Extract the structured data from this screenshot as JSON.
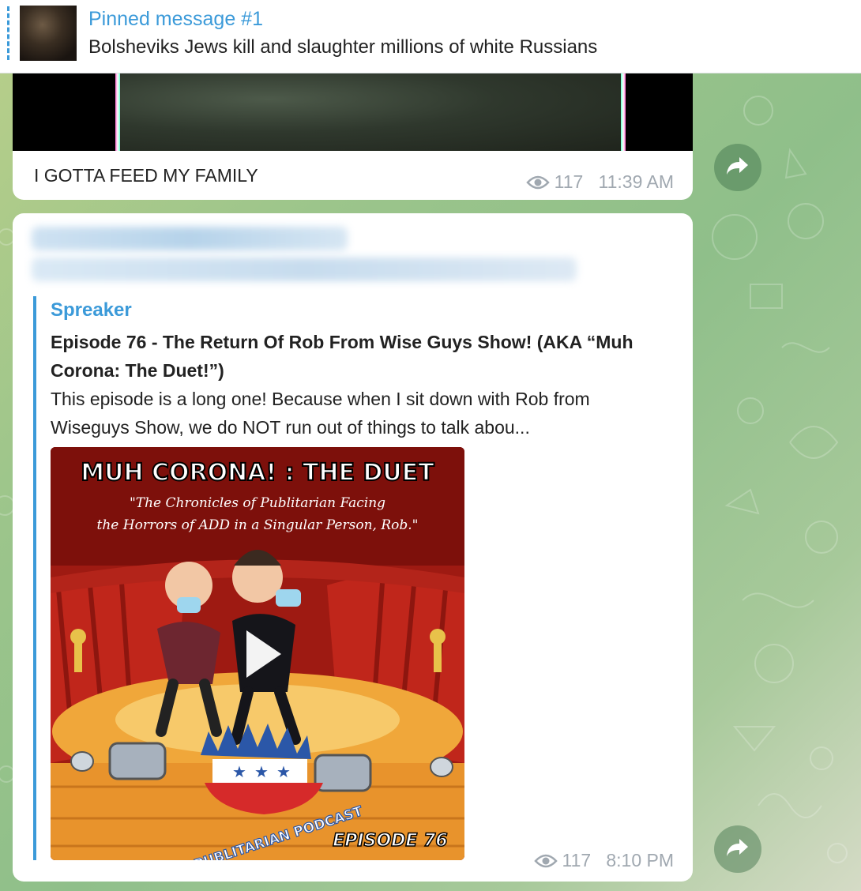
{
  "pinned": {
    "title": "Pinned message #1",
    "text": "Bolsheviks Jews kill and slaughter millions of white Russians"
  },
  "message1": {
    "caption": "I GOTTA FEED MY FAMILY",
    "views": "117",
    "time": "11:39 AM"
  },
  "message2": {
    "preview": {
      "site": "Spreaker",
      "title": "Episode 76 - The Return Of Rob From Wise Guys Show! (AKA “Muh Corona: The Duet!”)",
      "description": "This episode is a long one! Because when I sit down with Rob from Wiseguys Show, we do NOT run out of things to talk abou...",
      "art": {
        "heading": "MUH CORONA! : THE DUET",
        "subtitle_line1": "\"The Chronicles of Publitarian Facing",
        "subtitle_line2": "the Horrors of ADD in a Singular Person, Rob.\"",
        "logo_text": "PUBLITARIAN PODCAST",
        "episode": "EPISODE 76"
      }
    },
    "views": "117",
    "time": "8:10 PM"
  },
  "icons": {
    "views": "eye-icon",
    "forward": "share-arrow-icon",
    "play": "play-icon"
  },
  "colors": {
    "accent": "#3b9ad9",
    "meta": "#a0a8b0",
    "background": "#9cc58b"
  }
}
